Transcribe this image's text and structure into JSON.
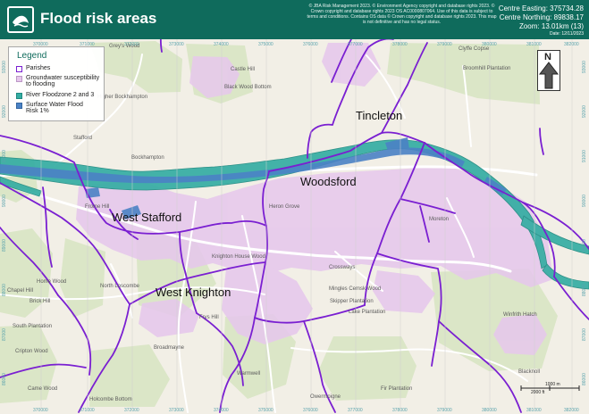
{
  "header": {
    "title": "Flood risk areas",
    "copyright": "© JBA Risk Management 2023. © Environment Agency copyright and database rights 2023. © Crown copyright and database rights 2023 OS AC0000807064. Use of this data is subject to terms and conditions. Contains OS data © Crown copyright and database rights 2023. This map is not definitive and has no legal status.",
    "centre_easting": "Centre Easting: 375734.28",
    "centre_northing": "Centre Northing: 89838.17",
    "zoom": "Zoom: 13.01km (13)",
    "date": "Date: 12/11/2023"
  },
  "legend": {
    "title": "Legend",
    "items": [
      {
        "label": "Parishes",
        "color": "#7a1fd1",
        "type": "outline"
      },
      {
        "label": "Groundwater susceptibility to flooding",
        "color": "#e6c8ec",
        "type": "fill"
      },
      {
        "label": "River Floodzone 2 and 3",
        "color": "#35ada3",
        "type": "fill"
      },
      {
        "label": "Surface Water Flood Risk 1%",
        "color": "#4b82c5",
        "type": "fill"
      }
    ]
  },
  "north": {
    "label": "N"
  },
  "scale": {
    "meters": "1000 m",
    "feet": "2000 ft"
  },
  "parishes": [
    "Tincleton",
    "Woodsford",
    "West Stafford",
    "West Knighton"
  ],
  "places": [
    {
      "name": "Grey's Wood"
    },
    {
      "name": "Higher Bockhampton"
    },
    {
      "name": "Stafford"
    },
    {
      "name": "Bockhampton"
    },
    {
      "name": "Frome Hill"
    },
    {
      "name": "Home Wood"
    },
    {
      "name": "Chapel Hill"
    },
    {
      "name": "North Loscombe"
    },
    {
      "name": "Brick Hill"
    },
    {
      "name": "South Plantation"
    },
    {
      "name": "Cripton Wood"
    },
    {
      "name": "Came Wood"
    },
    {
      "name": "Holcombe Bottom"
    },
    {
      "name": "Heron Grove"
    },
    {
      "name": "Knighton House Wood"
    },
    {
      "name": "Crossways"
    },
    {
      "name": "Moreton"
    },
    {
      "name": "Clyffe Copse"
    },
    {
      "name": "Broomhill Plantation"
    },
    {
      "name": "Black Wood Bottom"
    },
    {
      "name": "Castle Hill"
    },
    {
      "name": "Mingles Cemsk Wood"
    },
    {
      "name": "Skipper Plantation"
    },
    {
      "name": "Lake Plantation"
    },
    {
      "name": "Warmwell"
    },
    {
      "name": "Owermoigne"
    },
    {
      "name": "Fir Plantation"
    },
    {
      "name": "Winfrith Hatch"
    },
    {
      "name": "Blacknoll"
    },
    {
      "name": "Broadmayne"
    },
    {
      "name": "Frys Hill"
    }
  ],
  "grid": {
    "top": [
      "370000",
      "371000",
      "372000",
      "373000",
      "374000",
      "375000",
      "376000",
      "377000",
      "378000",
      "379000",
      "380000",
      "381000",
      "382000"
    ],
    "left": [
      "93000",
      "92000",
      "91000",
      "90000",
      "89000",
      "88000",
      "87000",
      "86000"
    ],
    "right": [
      "93000",
      "92000",
      "91000",
      "90000",
      "89000",
      "88000",
      "87000",
      "86000"
    ]
  },
  "colors": {
    "header": "#0f6b5c",
    "parish": "#7a1fd1",
    "groundwater": "#e6c8ec",
    "floodzone": "#35ada3",
    "surface": "#4b82c5",
    "base": "#f2efe6",
    "road": "#ffffff"
  }
}
